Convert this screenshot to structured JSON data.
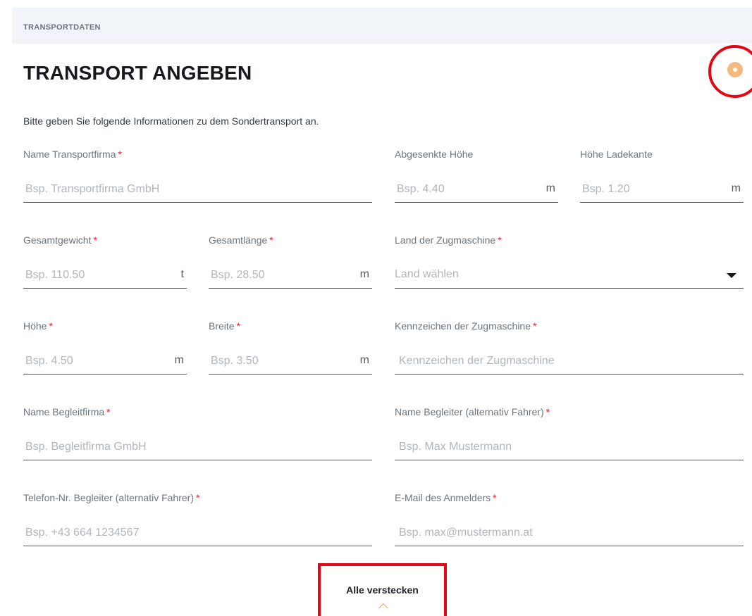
{
  "section": {
    "label": "TRANSPORTDATEN"
  },
  "card": {
    "title": "TRANSPORT ANGEBEN",
    "intro": "Bitte geben Sie folgende Informationen zu dem Sondertransport an.",
    "status_icon": "status-dot-icon",
    "status_color": "#f4b97c"
  },
  "annotation_color": "#e30613",
  "required_marker": "*",
  "fields": {
    "transportfirma": {
      "label": "Name Transportfirma",
      "placeholder": "Bsp. Transportfirma GmbH",
      "required": true
    },
    "abgesenkte_hoehe": {
      "label": "Abgesenkte Höhe",
      "placeholder": "Bsp. 4.40",
      "unit": "m",
      "required": false
    },
    "hoehe_ladekante": {
      "label": "Höhe Ladekante",
      "placeholder": "Bsp. 1.20",
      "unit": "m",
      "required": false
    },
    "gesamtgewicht": {
      "label": "Gesamtgewicht",
      "placeholder": "Bsp. 110.50",
      "unit": "t",
      "required": true
    },
    "gesamtlaenge": {
      "label": "Gesamtlänge",
      "placeholder": "Bsp. 28.50",
      "unit": "m",
      "required": true
    },
    "land_zugmaschine": {
      "label": "Land der Zugmaschine",
      "value": "Land wählen",
      "required": true
    },
    "hoehe": {
      "label": "Höhe",
      "placeholder": "Bsp. 4.50",
      "unit": "m",
      "required": true
    },
    "breite": {
      "label": "Breite",
      "placeholder": "Bsp. 3.50",
      "unit": "m",
      "required": true
    },
    "kennzeichen": {
      "label": "Kennzeichen der Zugmaschine",
      "placeholder": "Kennzeichen der Zugmaschine",
      "required": true
    },
    "begleitfirma": {
      "label": "Name Begleitfirma",
      "placeholder": "Bsp. Begleitfirma GmbH",
      "required": true
    },
    "begleiter_name": {
      "label": "Name Begleiter (alternativ Fahrer)",
      "placeholder": "Bsp. Max Mustermann",
      "required": true
    },
    "begleiter_telefon": {
      "label": "Telefon-Nr. Begleiter (alternativ Fahrer)",
      "placeholder": "Bsp. +43 664 1234567",
      "required": true
    },
    "email_anmelder": {
      "label": "E-Mail des Anmelders",
      "placeholder": "Bsp. max@mustermann.at",
      "required": true
    }
  },
  "toggle": {
    "label": "Alle verstecken",
    "icon": "chevron-up-icon"
  }
}
